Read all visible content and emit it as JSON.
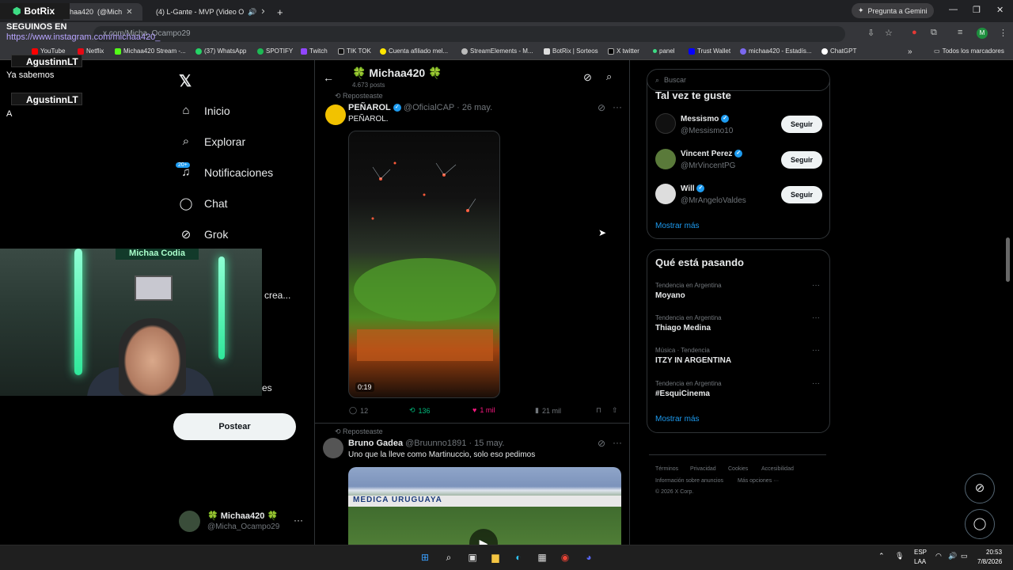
{
  "browser": {
    "tabs": [
      {
        "label": "BotRix"
      },
      {
        "label": "haa420"
      },
      {
        "label": "(@Mich"
      },
      {
        "label": "(4) L-Gante - MVP (Video O"
      }
    ],
    "new_tab": "+",
    "gemini_button": "Pregunta a Gemini",
    "url": "x.com/Micha_Ocampo29",
    "bookmarks": [
      "YouTube",
      "Netflix",
      "Michaa420 Stream -...",
      "(37) WhatsApp",
      "SPOTIFY",
      "Twitch",
      "TIK TOK",
      "Cuenta afiliado mel...",
      "StreamElements - M...",
      "BotRix | Sorteos",
      "X twitter",
      "panel",
      "Trust Wallet",
      "michaa420 - Estadís...",
      "ChatGPT"
    ],
    "all_bookmarks": "Todos los marcadores",
    "profile_initial": "M"
  },
  "overlay": {
    "botrix": "BotRix",
    "follow_us": "SEGUINOS EN",
    "instagram": "https://www.instagram.com/michaa420_",
    "chat": [
      {
        "user": "AgustinnLT",
        "message": "Ya sabemos"
      },
      {
        "user": "AgustinnLT",
        "message": "A"
      }
    ],
    "cam_sign": "Michaa Codia"
  },
  "nav": {
    "items": [
      {
        "label": "Inicio",
        "icon": "home-icon"
      },
      {
        "label": "Explorar",
        "icon": "search-icon"
      },
      {
        "label": "Notificaciones",
        "icon": "bell-icon"
      },
      {
        "label": "Chat",
        "icon": "chat-icon"
      },
      {
        "label": "Grok",
        "icon": "grok-icon"
      }
    ],
    "notif_badge": "20+",
    "hidden_crea": "crea...",
    "hidden_es": "es",
    "post_button": "Postear",
    "profile_name": "🍀 Michaa420 🍀",
    "profile_handle": "@Micha_Ocampo29",
    "more": "···"
  },
  "profile_header": {
    "title": "🍀 Michaa420 🍀",
    "posts": "4.673 posts"
  },
  "feed": [
    {
      "repost_label": "Reposteaste",
      "name": "PEÑAROL",
      "handle": "@OficialCAP",
      "date": "· 26 may.",
      "text": "PEÑAROL.",
      "video_time": "0:19",
      "replies": "12",
      "reposts": "136",
      "likes": "1 mil",
      "views": "21 mil"
    },
    {
      "repost_label": "Reposteaste",
      "name": "Bruno Gadea",
      "handle": "@Bruunno1891",
      "date": "· 15 may.",
      "text": "Uno que la lleve como Martinuccio, solo eso pedimos",
      "banner": "MEDICA URUGUAYA"
    }
  ],
  "search": {
    "placeholder": "Buscar"
  },
  "who_to_follow": {
    "title": "Tal vez te guste",
    "users": [
      {
        "name": "Messismo",
        "handle": "@Messismo10",
        "button": "Seguir"
      },
      {
        "name": "Vincent Perez",
        "handle": "@MrVincentPG",
        "button": "Seguir"
      },
      {
        "name": "Will",
        "handle": "@MrAngeloValdes",
        "button": "Seguir"
      }
    ],
    "show_more": "Mostrar más"
  },
  "trends": {
    "title": "Qué está pasando",
    "items": [
      {
        "context": "Tendencia en Argentina",
        "name": "Moyano"
      },
      {
        "context": "Tendencia en Argentina",
        "name": "Thiago Medina"
      },
      {
        "context": "Música · Tendencia",
        "name": "ITZY IN ARGENTINA"
      },
      {
        "context": "Tendencia en Argentina",
        "name": "#EsquiCinema"
      }
    ],
    "show_more": "Mostrar más"
  },
  "footer": {
    "links": [
      "Términos",
      "Privacidad",
      "Cookies",
      "Accesibilidad",
      "Información sobre anuncios",
      "Más opciones ···"
    ],
    "copyright": "© 2026 X Corp."
  },
  "taskbar": {
    "lang1": "ESP",
    "lang2": "LAA",
    "time": "20:53",
    "date": "7/8/2026"
  },
  "colors": {
    "accent": "#1d9bf0",
    "like": "#f91880",
    "repost": "#00ba7c"
  }
}
